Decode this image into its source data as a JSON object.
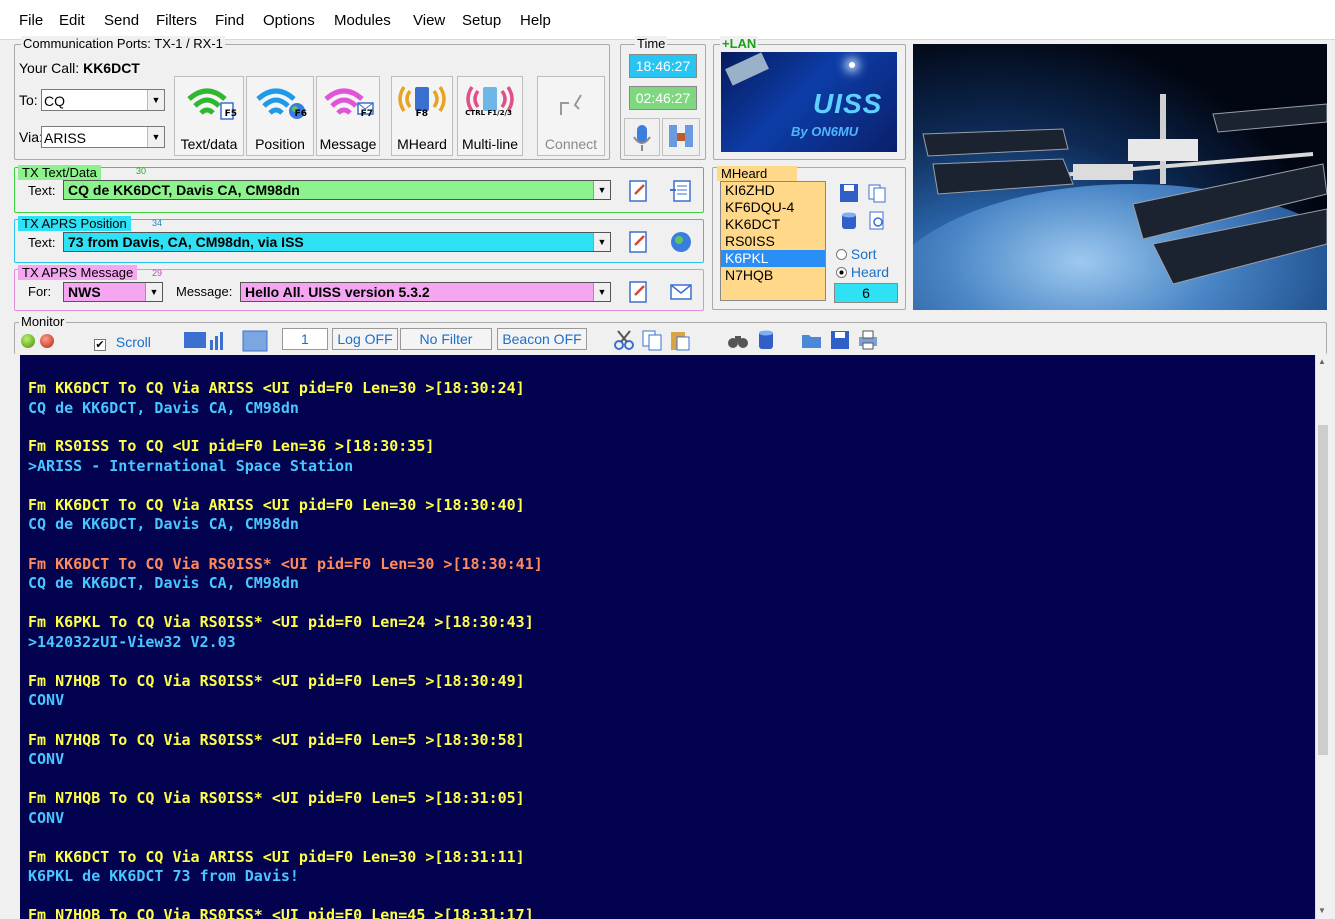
{
  "menu": [
    "File",
    "Edit",
    "Send",
    "Filters",
    "Find",
    "Options",
    "Modules",
    "View",
    "Setup",
    "Help"
  ],
  "ports": {
    "title": "Communication Ports: TX-1 / RX-1",
    "yourcall_label": "Your Call:",
    "yourcall": "KK6DCT",
    "to_label": "To:",
    "to_value": "CQ",
    "via_label": "Via:",
    "via_value": "ARISS"
  },
  "buttons": [
    {
      "label": "Text/data",
      "key": "F5",
      "icon": "wifi-doc-icon"
    },
    {
      "label": "Position",
      "key": "F6",
      "icon": "wifi-globe-icon"
    },
    {
      "label": "Message",
      "key": "F7",
      "icon": "wifi-envelope-icon"
    },
    {
      "label": "MHeard",
      "key": "F8",
      "icon": "radio-waves-icon"
    },
    {
      "label": "Multi-line",
      "key": "CTRL F1/2/3",
      "icon": "radio-multi-icon"
    },
    {
      "label": "Connect",
      "key": "",
      "icon": "plug-icon"
    }
  ],
  "time": {
    "title": "Time",
    "local": "18:46:27",
    "utc": "02:46:27"
  },
  "lan": {
    "title": "+LAN",
    "logo_text": "UISS",
    "logo_sub": "By ON6MU"
  },
  "tx_text": {
    "title": "TX Text/Data",
    "count": "30",
    "label": "Text:",
    "value": "CQ de KK6DCT, Davis CA, CM98dn"
  },
  "tx_pos": {
    "title": "TX APRS Position",
    "count": "34",
    "label": "Text:",
    "value": "73 from Davis, CA, CM98dn, via ISS"
  },
  "tx_msg": {
    "title": "TX APRS Message",
    "count": "29",
    "for_label": "For:",
    "for_value": "NWS",
    "msg_label": "Message:",
    "msg_value": "Hello All. UISS version 5.3.2"
  },
  "mheard": {
    "title": "MHeard",
    "items": [
      "KI6ZHD",
      "KF6DQU-4",
      "KK6DCT",
      "RS0ISS",
      "K6PKL",
      "N7HQB"
    ],
    "selected": "K6PKL",
    "sort_label": "Sort",
    "heard_label": "Heard",
    "count": "6"
  },
  "monitor_bar": {
    "title": "Monitor",
    "scroll_label": "Scroll",
    "counter": "1",
    "log": "Log OFF",
    "filter": "No Filter",
    "beacon": "Beacon OFF"
  },
  "colors": {
    "monitor_bg": "#02024f",
    "header_yellow": "#ffff4a",
    "body_cyan": "#49c6ff",
    "own_orange": "#ff8a5c",
    "tx_text_bg": "#8cf28c",
    "tx_pos_bg": "#2ee1f5",
    "tx_msg_bg": "#f5a6f0",
    "mheard_bg": "#ffd88a"
  },
  "monitor_lines": [
    {
      "text": "Fm KK6DCT To CQ Via ARISS <UI pid=F0 Len=30 >[18:30:24]",
      "style": "Y"
    },
    {
      "text": "CQ de KK6DCT, Davis CA, CM98dn",
      "style": "B"
    },
    {
      "text": "Fm RS0ISS To CQ <UI pid=F0 Len=36 >[18:30:35]",
      "style": "Y"
    },
    {
      "text": ">ARISS - International Space Station",
      "style": "B"
    },
    {
      "text": "Fm KK6DCT To CQ Via ARISS <UI pid=F0 Len=30 >[18:30:40]",
      "style": "Y"
    },
    {
      "text": "CQ de KK6DCT, Davis CA, CM98dn",
      "style": "B"
    },
    {
      "text": "Fm KK6DCT To CQ Via RS0ISS* <UI pid=F0 Len=30 >[18:30:41]",
      "style": "O"
    },
    {
      "text": "CQ de KK6DCT, Davis CA, CM98dn",
      "style": "B"
    },
    {
      "text": "Fm K6PKL To CQ Via RS0ISS* <UI pid=F0 Len=24 >[18:30:43]",
      "style": "Y"
    },
    {
      "text": ">142032zUI-View32 V2.03",
      "style": "B"
    },
    {
      "text": "Fm N7HQB To CQ Via RS0ISS* <UI pid=F0 Len=5 >[18:30:49]",
      "style": "Y"
    },
    {
      "text": "CONV",
      "style": "B"
    },
    {
      "text": "Fm N7HQB To CQ Via RS0ISS* <UI pid=F0 Len=5 >[18:30:58]",
      "style": "Y"
    },
    {
      "text": "CONV",
      "style": "B"
    },
    {
      "text": "Fm N7HQB To CQ Via RS0ISS* <UI pid=F0 Len=5 >[18:31:05]",
      "style": "Y"
    },
    {
      "text": "CONV",
      "style": "B"
    },
    {
      "text": "Fm KK6DCT To CQ Via ARISS <UI pid=F0 Len=30 >[18:31:11]",
      "style": "Y"
    },
    {
      "text": "K6PKL de KK6DCT 73 from Davis!",
      "style": "B"
    },
    {
      "text": "Fm N7HQB To CQ Via RS0ISS* <UI pid=F0 Len=45 >[18:31:17]",
      "style": "Y"
    }
  ]
}
